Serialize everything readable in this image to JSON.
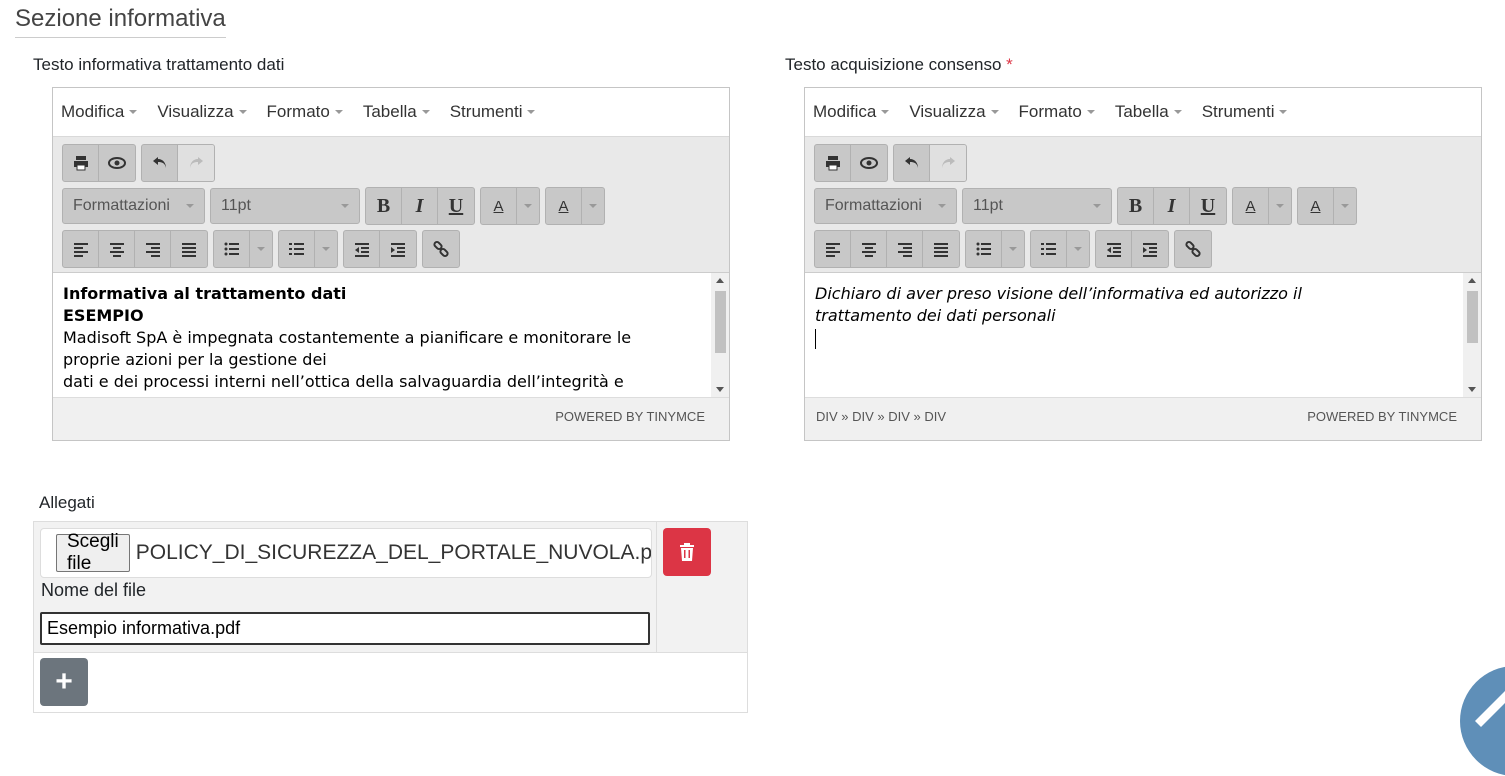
{
  "section": {
    "title": "Sezione informativa"
  },
  "editor1": {
    "label": "Testo informativa trattamento dati",
    "menu": [
      "Modifica",
      "Visualizza",
      "Formato",
      "Tabella",
      "Strumenti"
    ],
    "format_select": "Formattazioni",
    "size_select": "11pt",
    "content": {
      "heading1": "Informativa al trattamento dati",
      "heading2": "ESEMPIO",
      "lines": [
        "Madisoft SpA è impegnata costantemente a pianificare e monitorare le",
        "proprie azioni per la gestione dei",
        "dati e dei processi interni nell’ottica della salvaguardia dell’integrità e"
      ]
    },
    "status_path": "",
    "powered": "POWERED BY TINYMCE"
  },
  "editor2": {
    "label": "Testo acquisizione consenso",
    "required_mark": "*",
    "menu": [
      "Modifica",
      "Visualizza",
      "Formato",
      "Tabella",
      "Strumenti"
    ],
    "format_select": "Formattazioni",
    "size_select": "11pt",
    "content": {
      "lines": [
        "Dichiaro di aver preso visione dell’informativa ed autorizzo il",
        "trattamento dei dati personali"
      ]
    },
    "status_path": "DIV » DIV » DIV » DIV",
    "powered": "POWERED BY TINYMCE"
  },
  "attachments": {
    "label": "Allegati",
    "choose_label": "Scegli file",
    "chosen_file": "POLICY_DI_SICUREZZA_DEL_PORTALE_NUVOLA.pdf",
    "name_label": "Nome del file",
    "name_value": "Esempio informativa.pdf",
    "add_label": "+"
  },
  "colors": {
    "danger": "#dc3545",
    "secondary": "#6c757d",
    "accent": "#5f8fb8"
  }
}
